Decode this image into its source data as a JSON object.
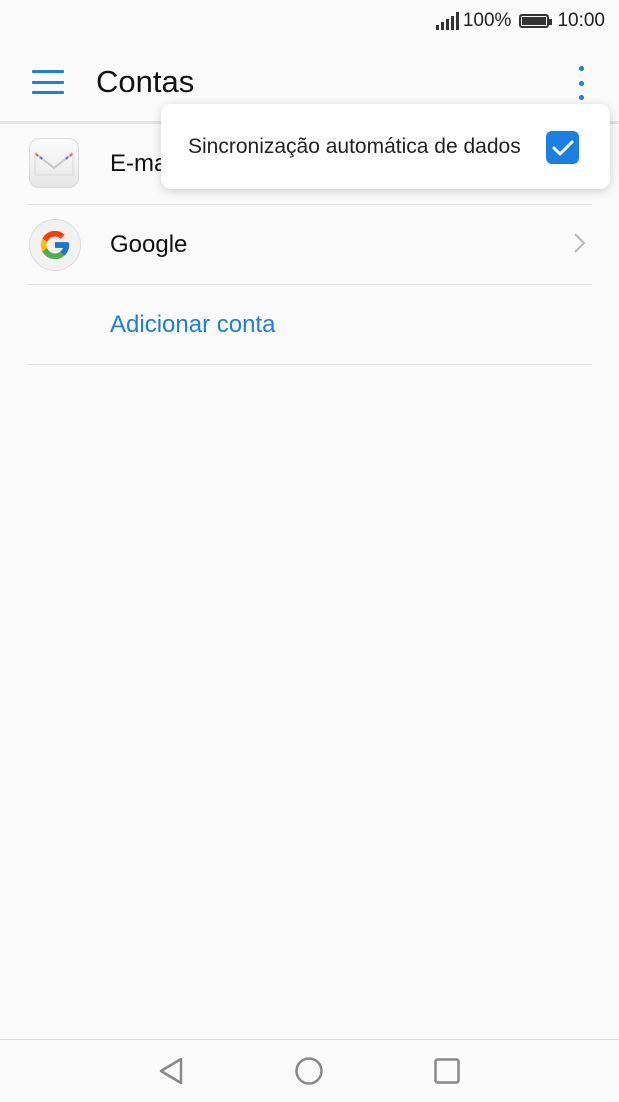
{
  "status_bar": {
    "battery_percent": "100%",
    "time": "10:00",
    "signal_icon": "signal-icon",
    "battery_icon": "battery-icon"
  },
  "app_bar": {
    "title": "Contas",
    "menu_icon": "hamburger-menu-icon",
    "overflow_icon": "more-vert-icon",
    "accent_color": "#1a7fe0"
  },
  "accounts": {
    "items": [
      {
        "label": "E-ma",
        "icon": "mail-icon"
      },
      {
        "label": "Google",
        "icon": "google-icon"
      }
    ],
    "add_label": "Adicionar conta"
  },
  "popup": {
    "auto_sync_label": "Sincronização automática de dados",
    "auto_sync_checked": true
  },
  "nav_bar": {
    "back_icon": "back-icon",
    "home_icon": "home-icon",
    "recents_icon": "recents-icon"
  }
}
